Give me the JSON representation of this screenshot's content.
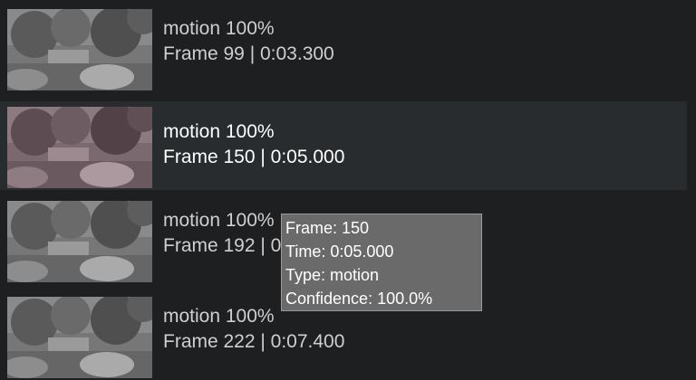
{
  "events": [
    {
      "type_label": "motion 100%",
      "frame_label": "Frame 99 | 0:03.300",
      "selected": false
    },
    {
      "type_label": "motion 100%",
      "frame_label": "Frame 150 | 0:05.000",
      "selected": true
    },
    {
      "type_label": "motion 100%",
      "frame_label": "Frame 192 | 0:06.400",
      "selected": false
    },
    {
      "type_label": "motion 100%",
      "frame_label": "Frame 222 | 0:07.400",
      "selected": false
    }
  ],
  "tooltip": {
    "frame": "Frame: 150",
    "time": "Time: 0:05.000",
    "type": "Type: motion",
    "confidence": "Confidence: 100.0%"
  },
  "colors": {
    "background": "#1e1f21",
    "selected_row": "#292c2e",
    "tooltip_bg": "#6a6a6a"
  }
}
